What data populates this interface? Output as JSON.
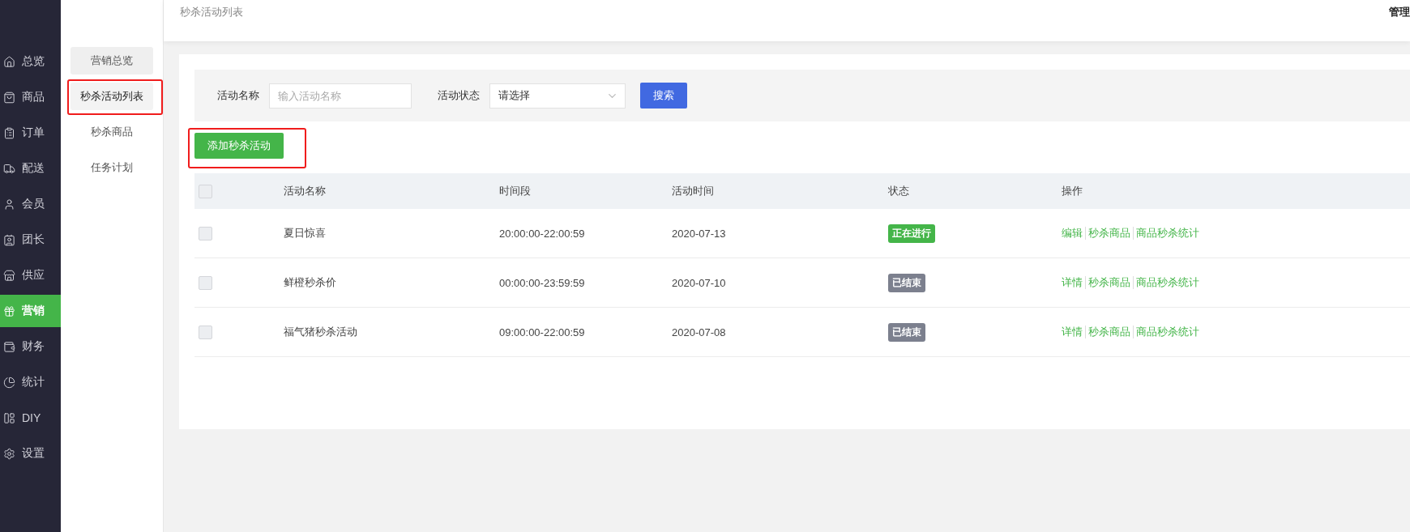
{
  "nav": [
    {
      "label": "总览",
      "selected": false
    },
    {
      "label": "商品",
      "selected": false
    },
    {
      "label": "订单",
      "selected": false
    },
    {
      "label": "配送",
      "selected": false
    },
    {
      "label": "会员",
      "selected": false
    },
    {
      "label": "团长",
      "selected": false
    },
    {
      "label": "供应",
      "selected": false
    },
    {
      "label": "营销",
      "selected": true
    },
    {
      "label": "财务",
      "selected": false
    },
    {
      "label": "统计",
      "selected": false
    },
    {
      "label": "DIY",
      "selected": false
    },
    {
      "label": "设置",
      "selected": false
    }
  ],
  "submenu": [
    {
      "label": "营销总览",
      "selected": false,
      "hovered": true,
      "highlighted": false
    },
    {
      "label": "秒杀活动列表",
      "selected": true,
      "hovered": false,
      "highlighted": true
    },
    {
      "label": "秒杀商品",
      "selected": false,
      "hovered": false,
      "highlighted": false
    },
    {
      "label": "任务计划",
      "selected": false,
      "hovered": false,
      "highlighted": false
    }
  ],
  "header": {
    "title": "秒杀活动列表",
    "user": "管理"
  },
  "filters": {
    "name_label": "活动名称",
    "name_placeholder": "输入活动名称",
    "status_label": "活动状态",
    "status_value": "请选择",
    "search_button": "搜索"
  },
  "add_button": {
    "label": "添加秒杀活动",
    "highlighted": true
  },
  "table": {
    "all_checked": false,
    "columns": [
      "活动名称",
      "时间段",
      "活动时间",
      "状态",
      "操作"
    ],
    "rows": [
      {
        "checked": false,
        "name": "夏日惊喜",
        "period": "20:00:00-22:00:59",
        "date": "2020-07-13",
        "status": {
          "label": "正在进行",
          "kind": "active"
        },
        "actions": [
          "编辑",
          "秒杀商品",
          "商品秒杀统计"
        ]
      },
      {
        "checked": false,
        "name": "鲜橙秒杀价",
        "period": "00:00:00-23:59:59",
        "date": "2020-07-10",
        "status": {
          "label": "已结束",
          "kind": "ended"
        },
        "actions": [
          "详情",
          "秒杀商品",
          "商品秒杀统计"
        ]
      },
      {
        "checked": false,
        "name": "福气猪秒杀活动",
        "period": "09:00:00-22:00:59",
        "date": "2020-07-08",
        "status": {
          "label": "已结束",
          "kind": "ended"
        },
        "actions": [
          "详情",
          "秒杀商品",
          "商品秒杀统计"
        ]
      }
    ]
  }
}
